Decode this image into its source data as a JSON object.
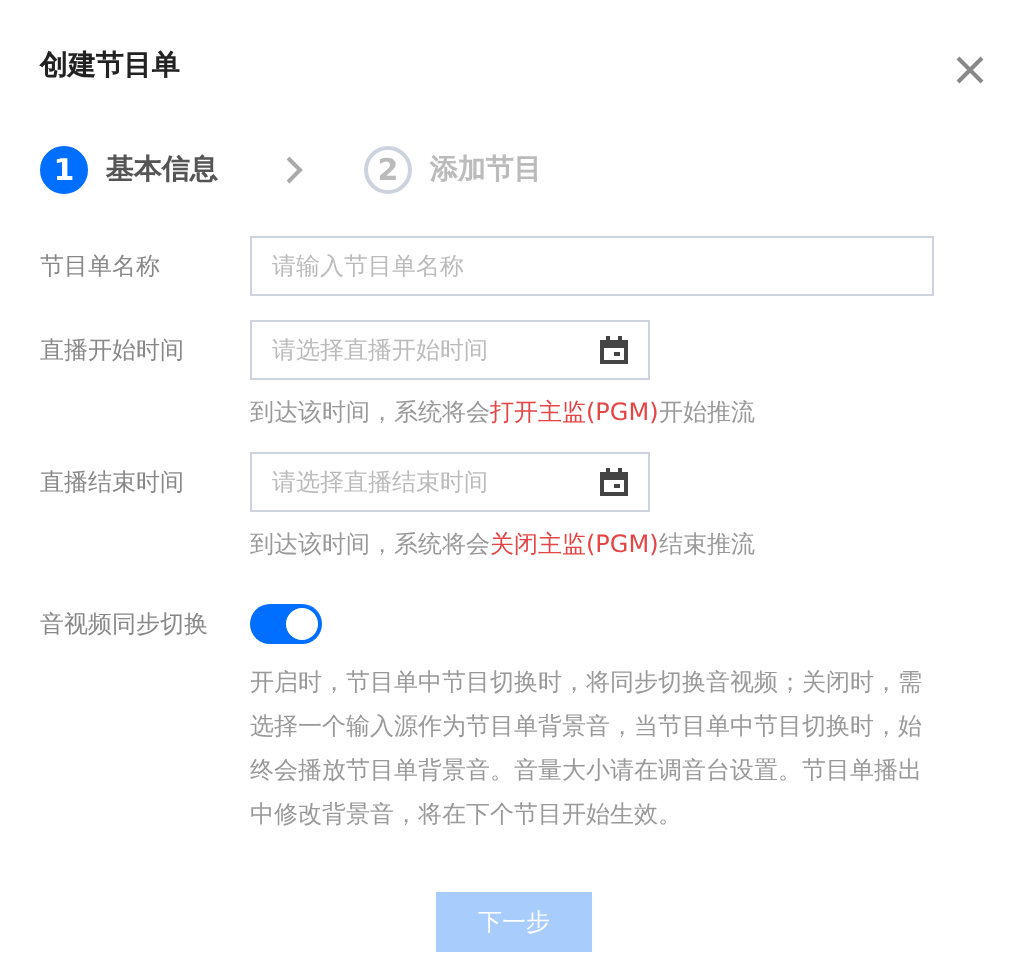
{
  "dialog": {
    "title": "创建节目单"
  },
  "steps": [
    {
      "number": "1",
      "label": "基本信息",
      "selected": true
    },
    {
      "number": "2",
      "label": "添加节目",
      "selected": false
    }
  ],
  "fields": [
    {
      "kind": "text",
      "label": "节目单名称",
      "placeholder": "请输入节目单名称"
    },
    {
      "kind": "date",
      "label": "直播开始时间",
      "placeholder": "请选择直播开始时间",
      "hint": {
        "before": "到达该时间，系统将会",
        "highlight": "打开主监(PGM)",
        "after": "开始推流"
      }
    },
    {
      "kind": "date",
      "label": "直播结束时间",
      "placeholder": "请选择直播结束时间",
      "hint": {
        "before": "到达该时间，系统将会",
        "highlight": "关闭主监(PGM)",
        "after": "结束推流"
      }
    },
    {
      "kind": "switch",
      "label": "音视频同步切换",
      "on": true,
      "description": "开启时，节目单中节目切换时，将同步切换音视频；关闭时，需选择一个输入源作为节目单背景音，当节目单中节目切换时，始终会播放节目单背景音。音量大小请在调音台设置。节目单播出中修改背景音，将在下个节目开始生效。"
    }
  ],
  "next_button": {
    "label": "下一步",
    "disabled": true
  }
}
